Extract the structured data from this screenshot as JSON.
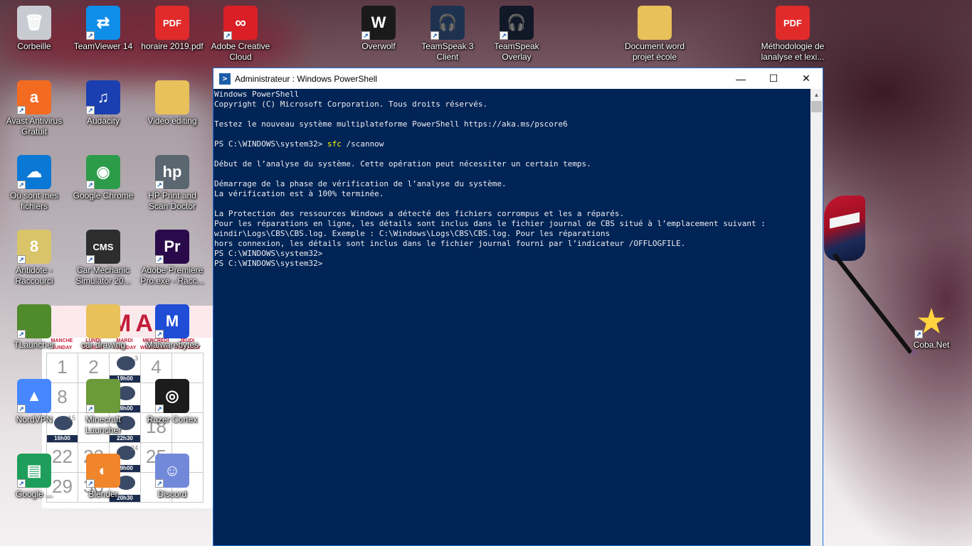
{
  "desktop": {
    "icons": [
      {
        "label": "Corbeille",
        "icon": "recycle-bin-icon",
        "color": "#c8ccd2"
      },
      {
        "label": "TeamViewer 14",
        "icon": "teamviewer-icon",
        "color": "#0e8ee9"
      },
      {
        "label": "horaire 2019.pdf",
        "icon": "pdf-icon",
        "color": "#e12b2b"
      },
      {
        "label": "Adobe Creative Cloud",
        "icon": "creative-cloud-icon",
        "color": "#da1f26"
      },
      {
        "label": "Overwolf",
        "icon": "overwolf-icon",
        "color": "#1a1a1a"
      },
      {
        "label": "TeamSpeak 3 Client",
        "icon": "teamspeak-icon",
        "color": "#1e3250"
      },
      {
        "label": "TeamSpeak Overlay",
        "icon": "teamspeak-overlay-icon",
        "color": "#111827"
      },
      {
        "label": "Document word projet école",
        "icon": "folder-icon",
        "color": "#e8c15a"
      },
      {
        "label": "Méthodologie de lanalyse et lexi...",
        "icon": "pdf-icon",
        "color": "#e12b2b"
      },
      {
        "label": "Avast Antivirus Gratuit",
        "icon": "avast-icon",
        "color": "#f26b21"
      },
      {
        "label": "Audacity",
        "icon": "audacity-icon",
        "color": "#1b3fb0"
      },
      {
        "label": "Video editing",
        "icon": "folder-icon",
        "color": "#e8c15a"
      },
      {
        "label": "Où sont mes fichiers",
        "icon": "onedrive-icon",
        "color": "#0a78d4"
      },
      {
        "label": "Google Chrome",
        "icon": "chrome-icon",
        "color": "#2c9c4a"
      },
      {
        "label": "HP Print and Scan Doctor",
        "icon": "hp-icon",
        "color": "#5a6670"
      },
      {
        "label": "Antidote - Raccourci",
        "icon": "antidote-icon",
        "color": "#d9c46a"
      },
      {
        "label": "Car Mechanic Simulator 20...",
        "icon": "car-mechanic-icon",
        "color": "#2d2d2d"
      },
      {
        "label": "Adobe Premiere Pro.exe - Racc...",
        "icon": "premiere-icon",
        "color": "#2a0a4a"
      },
      {
        "label": "TLauncher",
        "icon": "tlauncher-icon",
        "color": "#4f8a2b"
      },
      {
        "label": "car drawing",
        "icon": "folder-icon",
        "color": "#e8c15a"
      },
      {
        "label": "Malwarebytes",
        "icon": "malwarebytes-icon",
        "color": "#1f4dd6"
      },
      {
        "label": "NordVPN",
        "icon": "nordvpn-icon",
        "color": "#4687ff"
      },
      {
        "label": "Minecraft Launcher",
        "icon": "minecraft-icon",
        "color": "#6a9a3a"
      },
      {
        "label": "Razer Cortex",
        "icon": "razer-cortex-icon",
        "color": "#1c1c1c"
      },
      {
        "label": "Google ...",
        "icon": "google-sheets-icon",
        "color": "#1e9e5a"
      },
      {
        "label": "Blender",
        "icon": "blender-icon",
        "color": "#f0852b"
      },
      {
        "label": "Discord",
        "icon": "discord-icon",
        "color": "#7289da"
      },
      {
        "label": "Coba.Net",
        "icon": "star-icon",
        "color": "#ffd33d"
      }
    ],
    "calendar": {
      "month": "MAR",
      "day_headers": [
        "MANCHE SUNDAY",
        "LUNDI MONDAY",
        "MARDI TUESDAY",
        "MERCREDI WEDNESDAY",
        "JEUDI THURSDAY"
      ],
      "rows": [
        [
          {
            "num": "1"
          },
          {
            "num": "2"
          },
          {
            "time": "19h00",
            "small": "3",
            "logo": "islanders"
          },
          {
            "num": "4"
          },
          {
            "num": ""
          }
        ],
        [
          {
            "num": "8"
          },
          {
            "num": ""
          },
          {
            "time": "19h00",
            "logo": "predators"
          },
          {
            "num": ""
          },
          {
            "num": ""
          }
        ],
        [
          {
            "time": "16h00",
            "small": "15",
            "logo": "ducks"
          },
          {
            "num": ""
          },
          {
            "time": "22h30",
            "logo": "kings"
          },
          {
            "num": "18"
          },
          {
            "num": ""
          }
        ],
        [
          {
            "num": "22"
          },
          {
            "num": "23"
          },
          {
            "time": "19h00",
            "small": "24",
            "logo": "sabres"
          },
          {
            "num": "25"
          },
          {
            "num": ""
          }
        ],
        [
          {
            "num": "29"
          },
          {
            "num": "30"
          },
          {
            "time": "20h30",
            "logo": "blackhawks"
          },
          {
            "num": ""
          },
          {
            "num": ""
          }
        ]
      ]
    }
  },
  "powershell": {
    "title": "Administrateur : Windows PowerShell",
    "title_icon": "powershell-icon",
    "buttons": {
      "minimize": "—",
      "maximize": "☐",
      "close": "✕"
    },
    "lines": {
      "l1": "Windows PowerShell",
      "l2": "Copyright (C) Microsoft Corporation. Tous droits réservés.",
      "l3": "Testez le nouveau système multiplateforme PowerShell https://aka.ms/pscore6",
      "prompt": "PS C:\\WINDOWS\\system32> ",
      "cmd": "sfc",
      "arg": " /scannow",
      "l5": "Début de l’analyse du système. Cette opération peut nécessiter un certain temps.",
      "l6": "Démarrage de la phase de vérification de l’analyse du système.",
      "l7": "La vérification est à 100% terminée.",
      "l8": "La Protection des ressources Windows a détecté des fichiers corrompus et les a réparés.",
      "l9": "Pour les réparations en ligne, les détails sont inclus dans le fichier journal de CBS situé à l’emplacement suivant :",
      "l10": "windir\\Logs\\CBS\\CBS.log. Exemple : C:\\Windows\\Logs\\CBS\\CBS.log. Pour les réparations",
      "l11": "hors connexion, les détails sont inclus dans le fichier journal fourni par l’indicateur /OFFLOGFILE.",
      "l12": "PS C:\\WINDOWS\\system32>",
      "l13": "PS C:\\WINDOWS\\system32>"
    }
  },
  "colors": {
    "ps_background": "#012456",
    "ps_text": "#eeedf0",
    "ps_command": "#ffff00"
  }
}
